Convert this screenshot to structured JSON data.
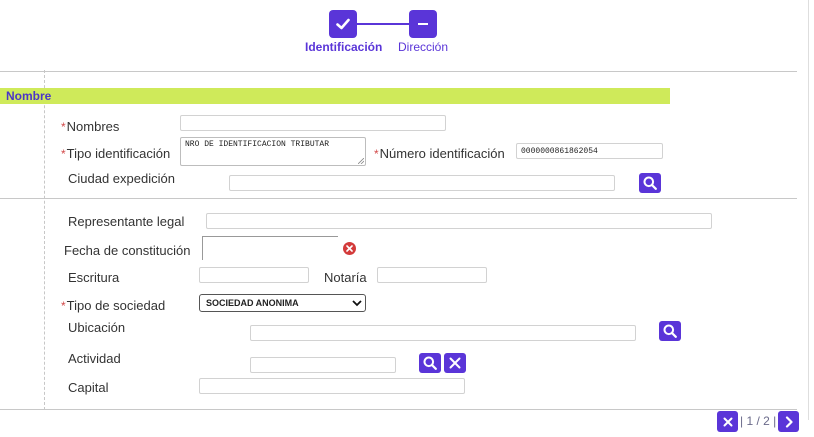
{
  "stepper": {
    "steps": [
      {
        "label": "Identificación",
        "state": "completed",
        "icon": "check-icon"
      },
      {
        "label": "Dirección",
        "state": "current",
        "icon": "minus-icon"
      }
    ]
  },
  "section": {
    "title": "Nombre"
  },
  "form": {
    "nombres": {
      "label": "Nombres",
      "required": "*",
      "value": ""
    },
    "tipo_identificacion": {
      "label": "Tipo identificación",
      "required": "*",
      "value": "NRO DE IDENTIFICACION TRIBUTAR"
    },
    "numero_identificacion": {
      "label": "Número identificación",
      "required": "*",
      "value": "0000000861862054"
    },
    "ciudad_expedicion": {
      "label": "Ciudad expedición",
      "value": ""
    },
    "representante_legal": {
      "label": "Representante legal",
      "value": ""
    },
    "fecha_constitucion": {
      "label": "Fecha de constitución",
      "value": ""
    },
    "escritura": {
      "label": "Escritura",
      "value": ""
    },
    "notaria": {
      "label": "Notaría",
      "value": ""
    },
    "tipo_sociedad": {
      "label": "Tipo de sociedad",
      "required": "*",
      "selected": "SOCIEDAD ANONIMA"
    },
    "ubicacion": {
      "label": "Ubicación",
      "value": ""
    },
    "actividad": {
      "label": "Actividad",
      "value": ""
    },
    "capital": {
      "label": "Capital",
      "value": ""
    }
  },
  "pager": {
    "text": "1 / 2",
    "separator": "|"
  },
  "colors": {
    "accent": "#5a35d8",
    "section_bar": "#cfea5a",
    "error": "#d33b3b",
    "required": "#d24a4a"
  }
}
